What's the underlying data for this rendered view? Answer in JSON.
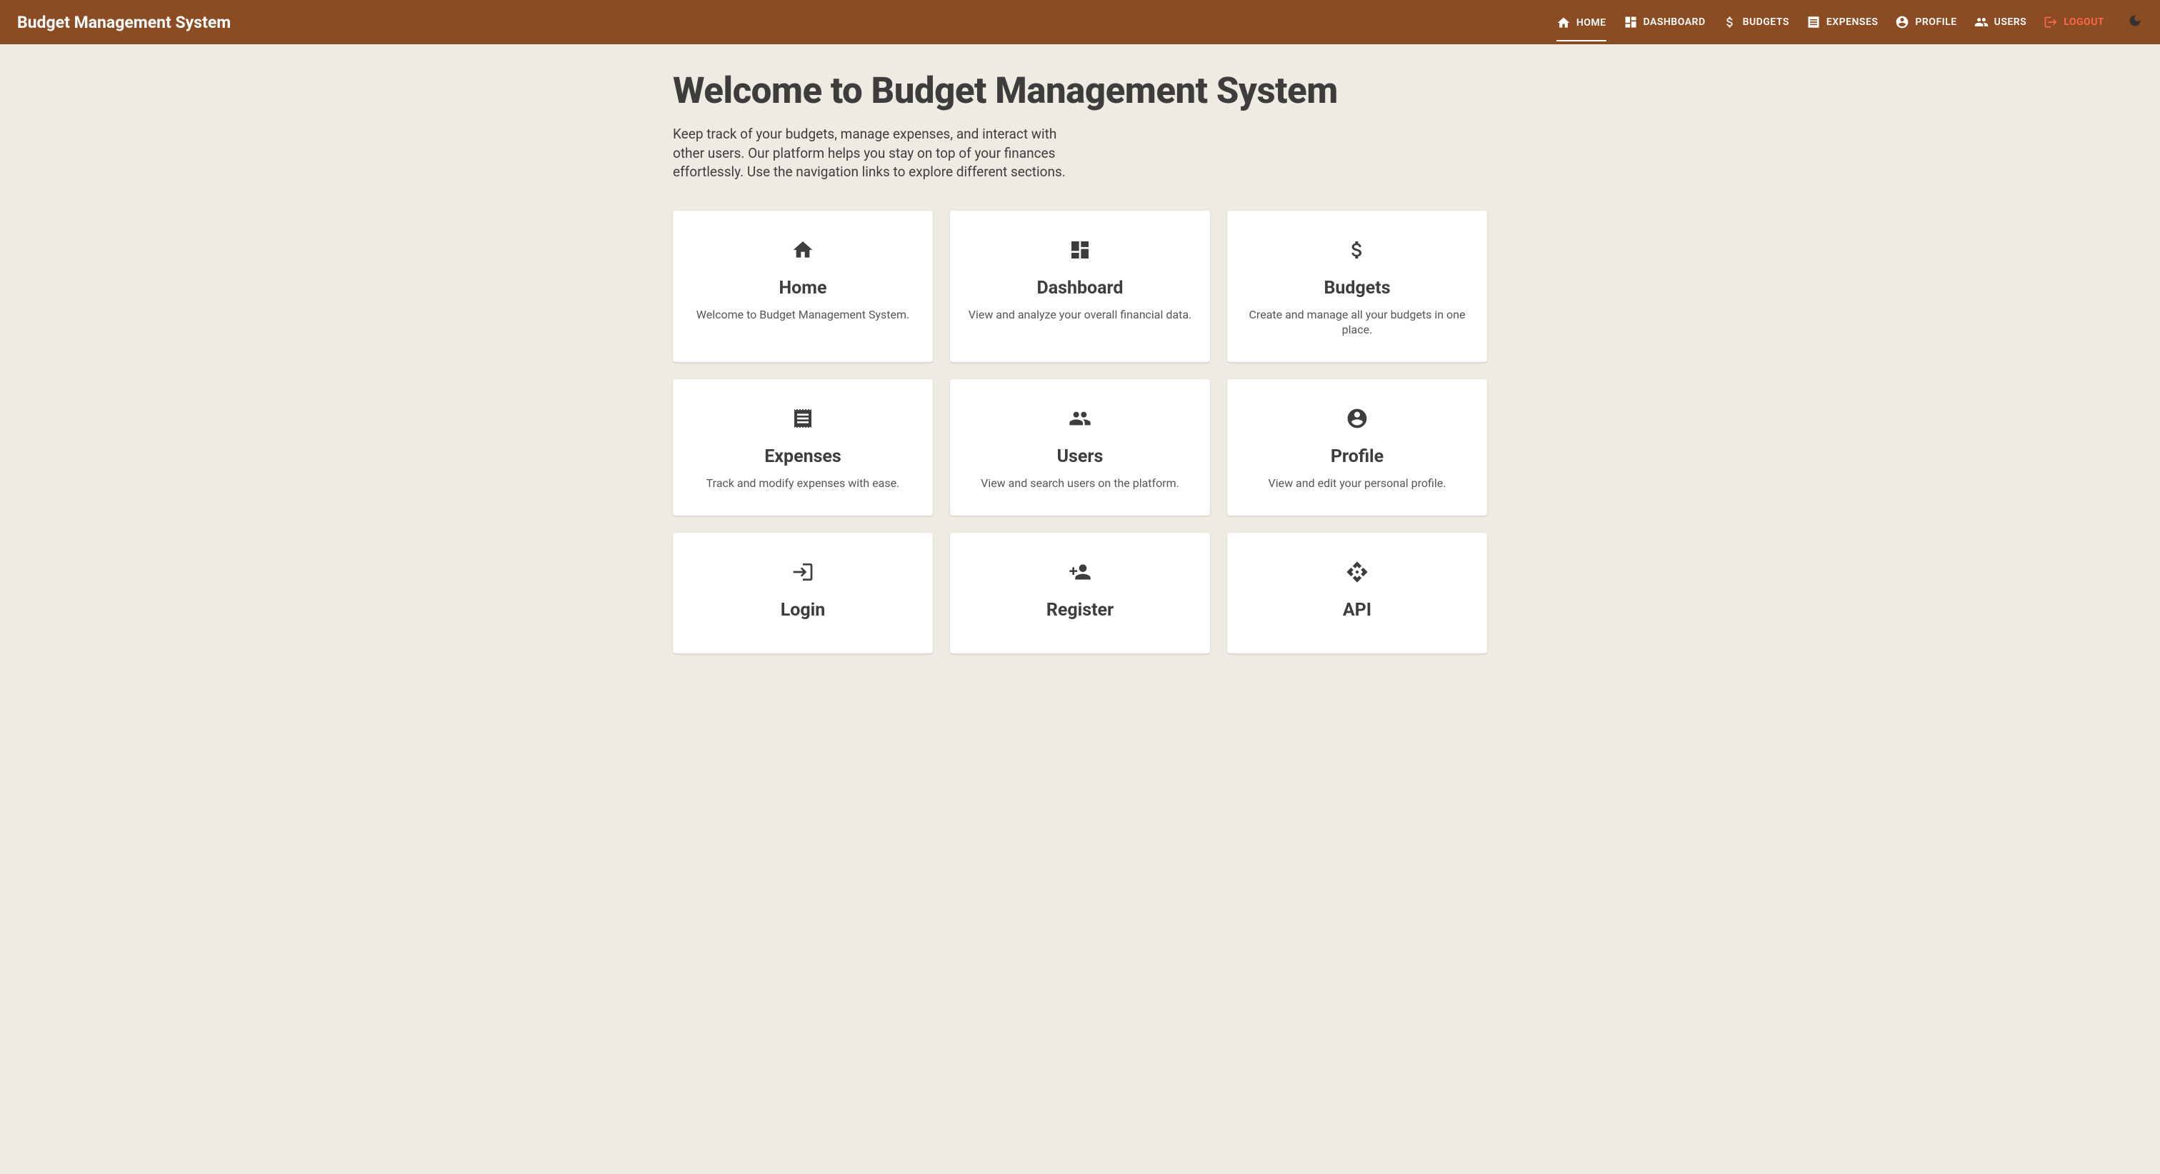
{
  "brand": "Budget Management System",
  "nav": [
    {
      "label": "HOME",
      "active": true
    },
    {
      "label": "DASHBOARD",
      "active": false
    },
    {
      "label": "BUDGETS",
      "active": false
    },
    {
      "label": "EXPENSES",
      "active": false
    },
    {
      "label": "PROFILE",
      "active": false
    },
    {
      "label": "USERS",
      "active": false
    },
    {
      "label": "LOGOUT",
      "active": false
    }
  ],
  "page": {
    "title": "Welcome to Budget Management System",
    "description": "Keep track of your budgets, manage expenses, and interact with other users. Our platform helps you stay on top of your finances effortlessly. Use the navigation links to explore different sections."
  },
  "cards": [
    {
      "title": "Home",
      "description": "Welcome to Budget Management System."
    },
    {
      "title": "Dashboard",
      "description": "View and analyze your overall financial data."
    },
    {
      "title": "Budgets",
      "description": "Create and manage all your budgets in one place."
    },
    {
      "title": "Expenses",
      "description": "Track and modify expenses with ease."
    },
    {
      "title": "Users",
      "description": "View and search users on the platform."
    },
    {
      "title": "Profile",
      "description": "View and edit your personal profile."
    },
    {
      "title": "Login",
      "description": ""
    },
    {
      "title": "Register",
      "description": ""
    },
    {
      "title": "API",
      "description": ""
    }
  ]
}
